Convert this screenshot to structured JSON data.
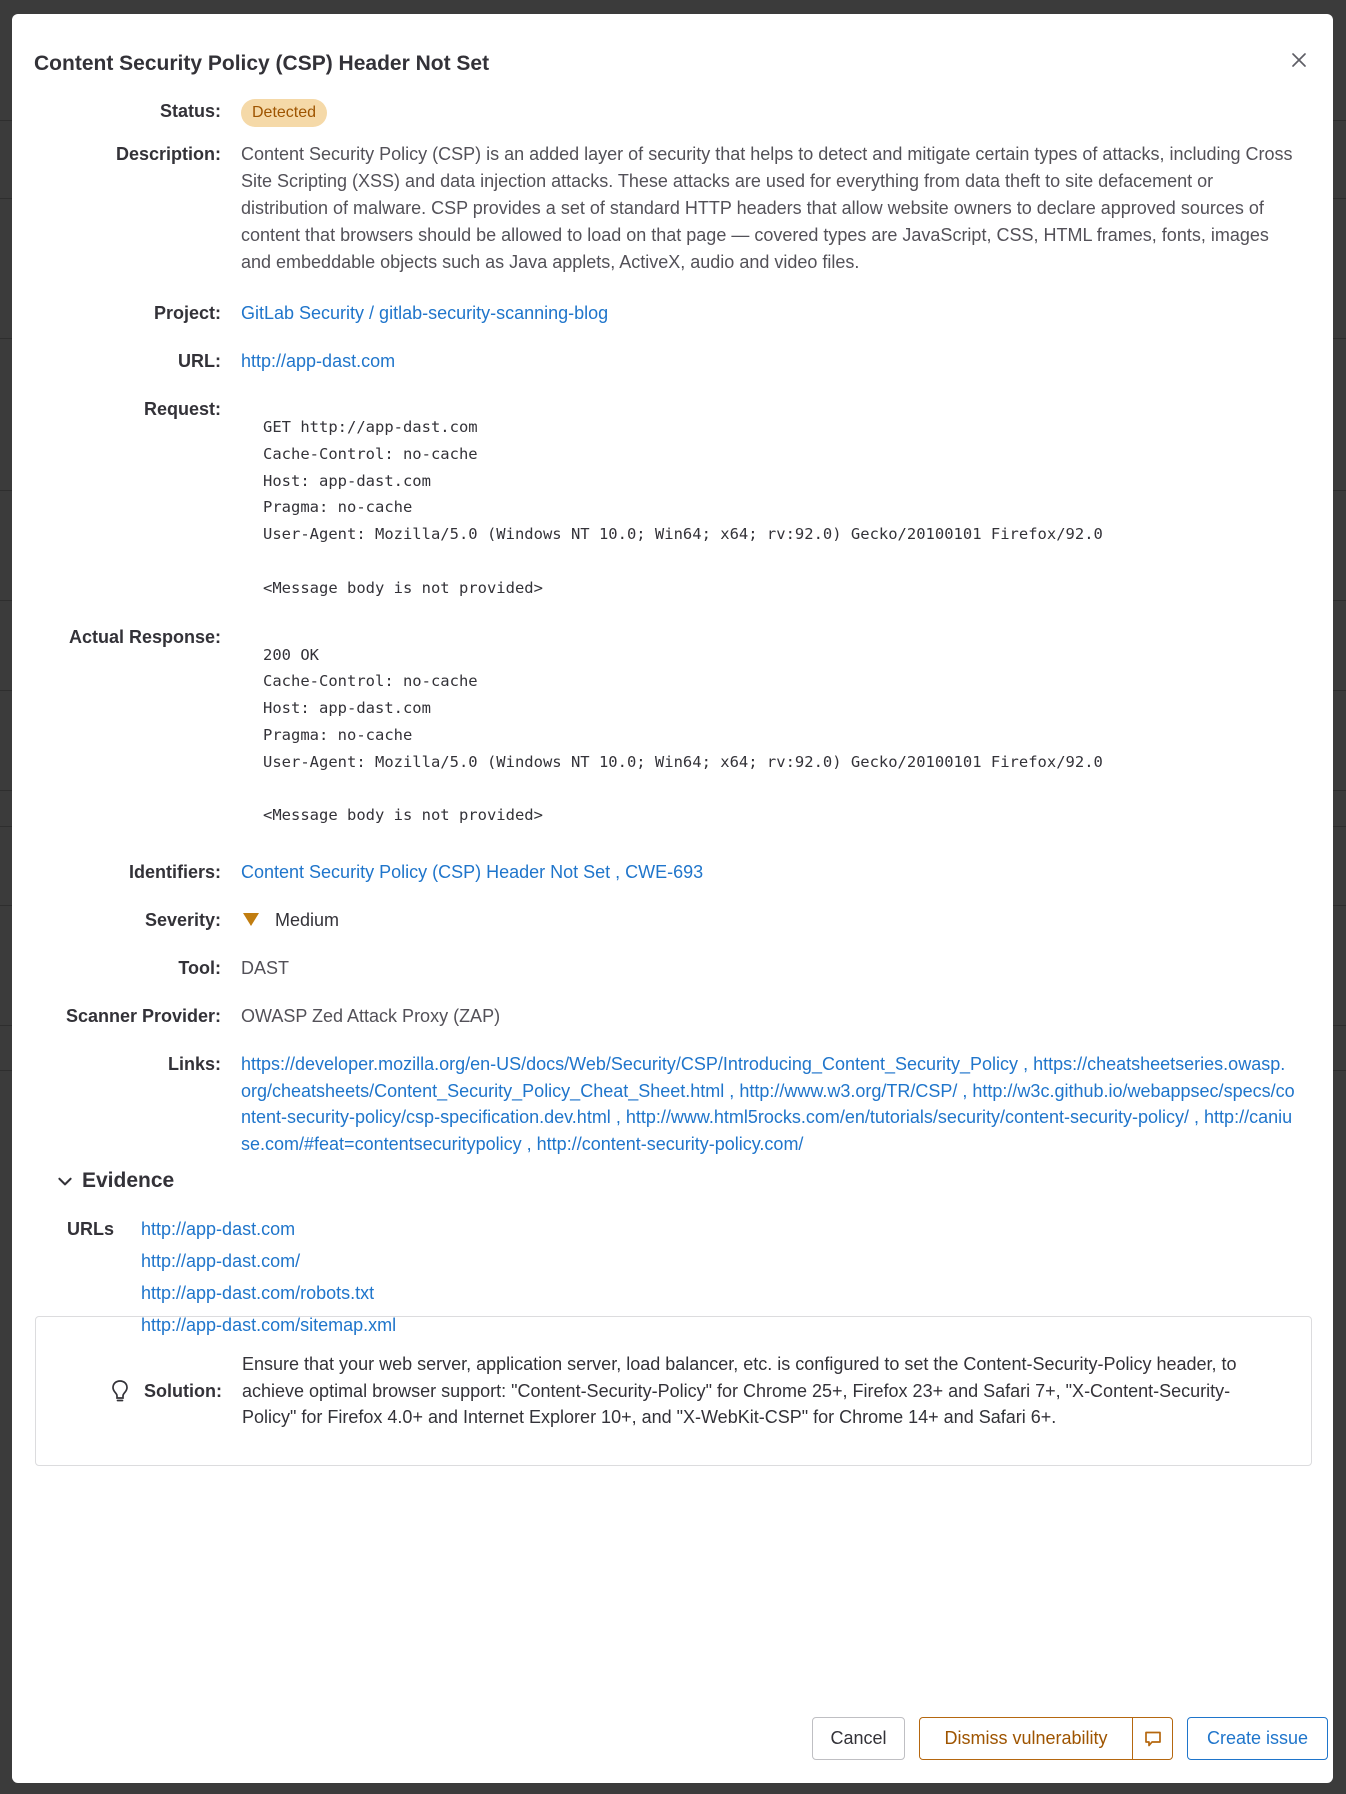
{
  "modal": {
    "title": "Content Security Policy (CSP) Header Not Set",
    "close_icon": "close-icon"
  },
  "details": {
    "status": {
      "label": "Status:",
      "value": "Detected"
    },
    "description": {
      "label": "Description:",
      "value": "Content Security Policy (CSP) is an added layer of security that helps to detect and mitigate certain types of attacks, including Cross Site Scripting (XSS) and data injection attacks. These attacks are used for everything from data theft to site defacement or distribution of malware. CSP provides a set of standard HTTP headers that allow website owners to declare approved sources of content that browsers should be allowed to load on that page — covered types are JavaScript, CSS, HTML frames, fonts, images and embeddable objects such as Java applets, ActiveX, audio and video files."
    },
    "project": {
      "label": "Project:",
      "value": "GitLab Security / gitlab-security-scanning-blog"
    },
    "url": {
      "label": "URL:",
      "value": "http://app-dast.com"
    },
    "request": {
      "label": "Request:",
      "value": "GET http://app-dast.com\nCache-Control: no-cache\nHost: app-dast.com\nPragma: no-cache\nUser-Agent: Mozilla/5.0 (Windows NT 10.0; Win64; x64; rv:92.0) Gecko/20100101 Firefox/92.0\n\n<Message body is not provided>"
    },
    "response": {
      "label": "Actual Response:",
      "value": "200 OK\nCache-Control: no-cache\nHost: app-dast.com\nPragma: no-cache\nUser-Agent: Mozilla/5.0 (Windows NT 10.0; Win64; x64; rv:92.0) Gecko/20100101 Firefox/92.0\n\n<Message body is not provided>"
    },
    "identifiers": {
      "label": "Identifiers:",
      "items": [
        "Content Security Policy (CSP) Header Not Set",
        "CWE-693"
      ],
      "separator": " , "
    },
    "severity": {
      "label": "Severity:",
      "value": "Medium",
      "color": "#c17d10"
    },
    "tool": {
      "label": "Tool:",
      "value": "DAST"
    },
    "scanner": {
      "label": "Scanner Provider:",
      "value": "OWASP Zed Attack Proxy (ZAP)"
    },
    "links": {
      "label": "Links:",
      "items": [
        "https://developer.mozilla.org/en-US/docs/Web/Security/CSP/Introducing_Content_Security_Policy",
        "https://cheatsheetseries.owasp.org/cheatsheets/Content_Security_Policy_Cheat_Sheet.html",
        "http://www.w3.org/TR/CSP/",
        "http://w3c.github.io/webappsec/specs/content-security-policy/csp-specification.dev.html",
        "http://www.html5rocks.com/en/tutorials/security/content-security-policy/",
        "http://caniuse.com/#feat=contentsecuritypolicy",
        "http://content-security-policy.com/"
      ],
      "separator": " , "
    }
  },
  "evidence": {
    "title": "Evidence",
    "urls_label": "URLs",
    "urls": [
      "http://app-dast.com",
      "http://app-dast.com/",
      "http://app-dast.com/robots.txt",
      "http://app-dast.com/sitemap.xml"
    ]
  },
  "solution": {
    "label": "Solution:",
    "value": "Ensure that your web server, application server, load balancer, etc. is configured to set the Content-Security-Policy header, to achieve optimal browser support: \"Content-Security-Policy\" for Chrome 25+, Firefox 23+ and Safari 7+, \"X-Content-Security-Policy\" for Firefox 4.0+ and Internet Explorer 10+, and \"X-WebKit-CSP\" for Chrome 14+ and Safari 6+."
  },
  "footer": {
    "cancel_label": "Cancel",
    "dismiss_label": "Dismiss vulnerability",
    "create_issue_label": "Create issue"
  },
  "colors": {
    "link": "#1f75cb",
    "warning": "#9e5400",
    "badge_bg": "#f5d9a8"
  }
}
